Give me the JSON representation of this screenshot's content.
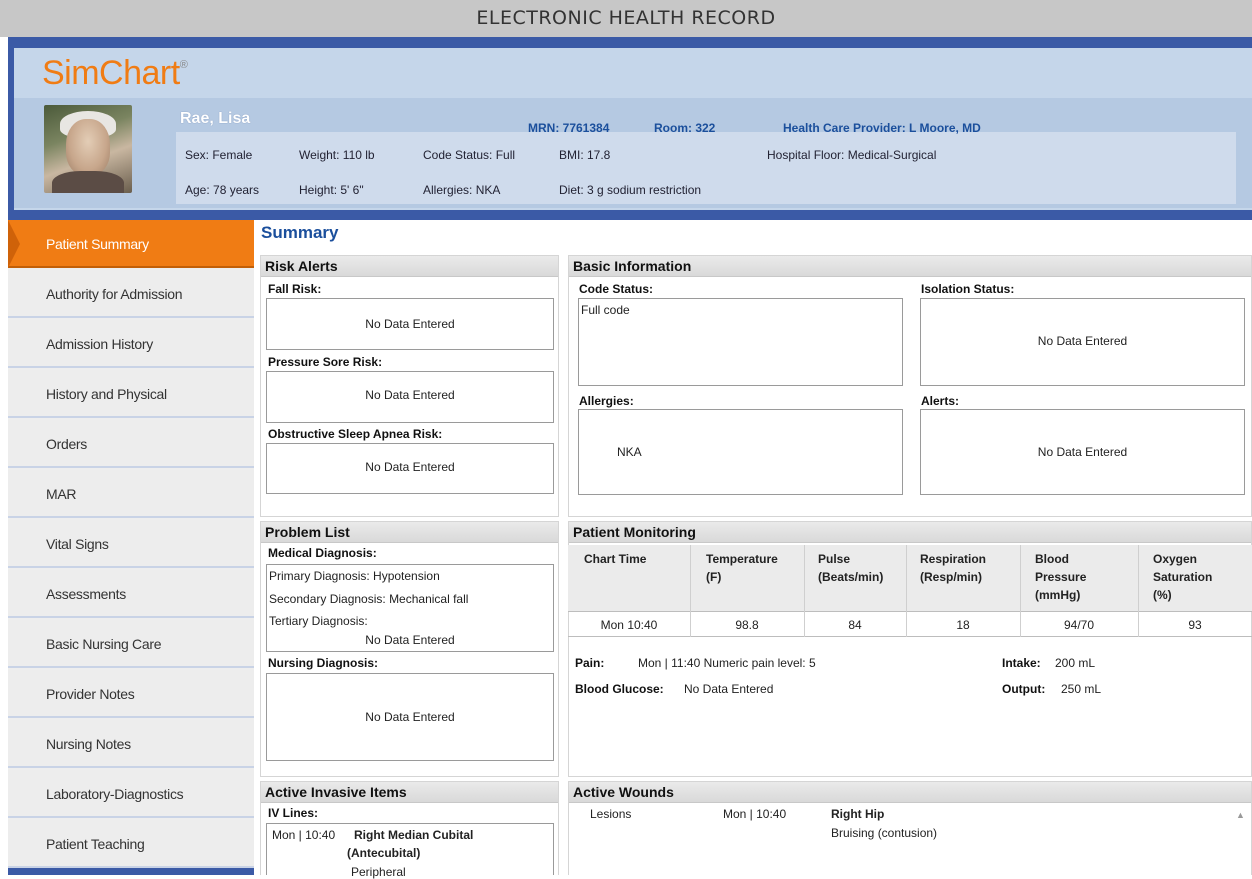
{
  "window_title": "ELECTRONIC HEALTH RECORD",
  "brand": {
    "name": "SimChart",
    "mark": "®"
  },
  "patient": {
    "name": "Rae, Lisa",
    "mrn": "MRN: 7761384",
    "room": "Room: 322",
    "provider": "Health Care Provider: L Moore, MD",
    "sex": "Sex: Female",
    "weight": "Weight: 110 lb",
    "code_status": "Code Status: Full",
    "bmi": "BMI: 17.8",
    "floor": "Hospital Floor: Medical-Surgical",
    "age": "Age: 78 years",
    "height": "Height: 5' 6\"",
    "allergies": "Allergies: NKA",
    "diet": "Diet: 3 g sodium restriction"
  },
  "nav": [
    "Patient Summary",
    "Authority for Admission",
    "Admission History",
    "History and Physical",
    "Orders",
    "MAR",
    "Vital Signs",
    "Assessments",
    "Basic Nursing Care",
    "Provider Notes",
    "Nursing Notes",
    "Laboratory-Diagnostics",
    "Patient Teaching"
  ],
  "summary_title": "Summary",
  "no_data": "No Data Entered",
  "risk_alerts": {
    "title": "Risk Alerts",
    "fall": "Fall Risk:",
    "pressure": "Pressure Sore Risk:",
    "osa": "Obstructive Sleep Apnea Risk:"
  },
  "basic_info": {
    "title": "Basic Information",
    "code_status_label": "Code Status:",
    "code_status_value": "Full code",
    "isolation_label": "Isolation Status:",
    "allergies_label": "Allergies:",
    "allergies_value": "NKA",
    "alerts_label": "Alerts:"
  },
  "problem_list": {
    "title": "Problem List",
    "medical_label": "Medical Diagnosis:",
    "primary": "Primary Diagnosis: Hypotension",
    "secondary": "Secondary Diagnosis: Mechanical fall",
    "tertiary": "Tertiary Diagnosis:",
    "nursing_label": "Nursing Diagnosis:"
  },
  "monitoring": {
    "title": "Patient Monitoring",
    "columns": [
      [
        "Chart Time"
      ],
      [
        "Temperature",
        "(F)"
      ],
      [
        "Pulse",
        "(Beats/min)"
      ],
      [
        "Respiration",
        "(Resp/min)"
      ],
      [
        "Blood",
        "Pressure",
        "(mmHg)"
      ],
      [
        "Oxygen",
        "Saturation",
        "(%)"
      ]
    ],
    "row": [
      "Mon 10:40",
      "98.8",
      "84",
      "18",
      "94/70",
      "93"
    ],
    "pain_label": "Pain:",
    "pain_value": "Mon | 11:40  Numeric pain level: 5",
    "glucose_label": "Blood Glucose:",
    "glucose_value": "No Data Entered",
    "intake_label": "Intake:",
    "intake_value": "200 mL",
    "output_label": "Output:",
    "output_value": "250 mL"
  },
  "invasive": {
    "title": "Active Invasive Items",
    "iv_label": "IV Lines:",
    "time": "Mon | 10:40",
    "site_line1": "Right Median Cubital",
    "site_line2": "(Antecubital)",
    "site_line3": "Peripheral"
  },
  "wounds": {
    "title": "Active Wounds",
    "type": "Lesions",
    "time": "Mon | 10:40",
    "location": "Right Hip",
    "description": "Bruising (contusion)"
  }
}
